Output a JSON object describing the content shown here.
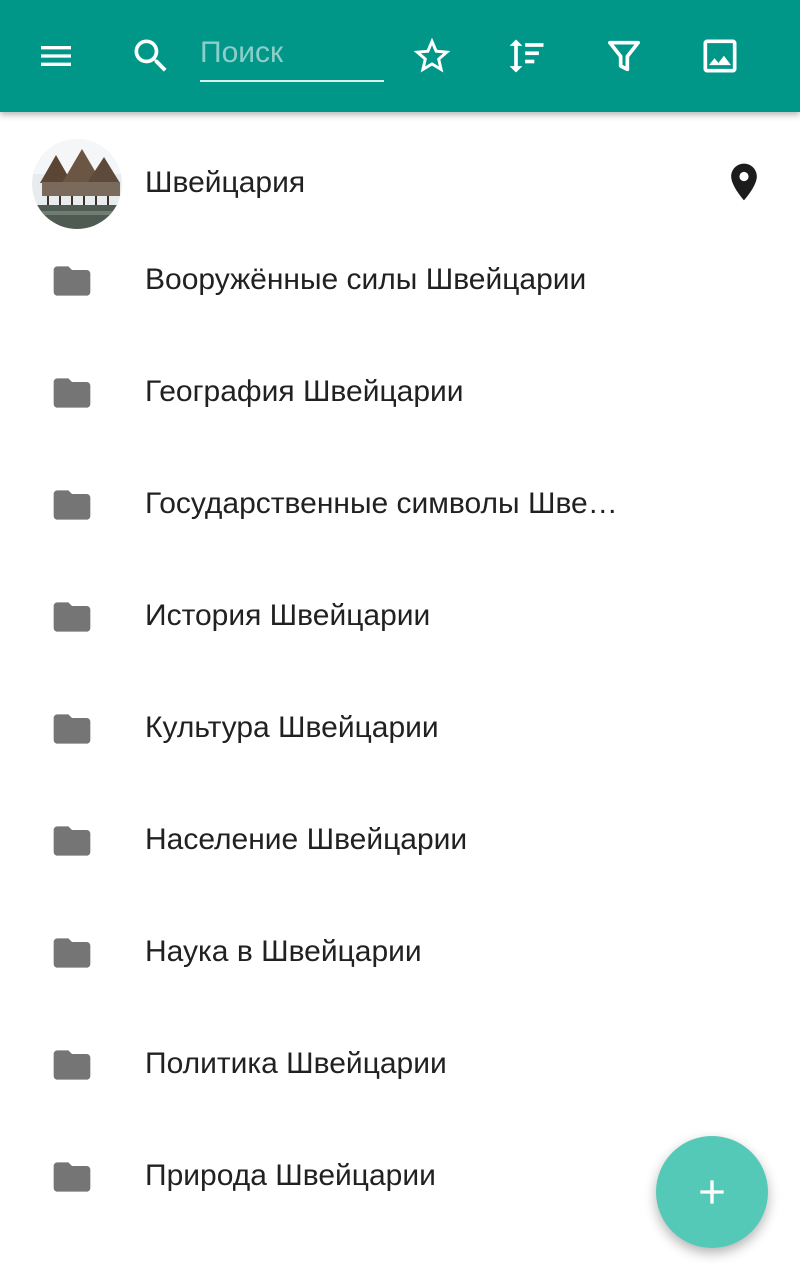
{
  "colors": {
    "toolbar": "#009688",
    "fab": "#55c9b7",
    "icon_gray": "#757575",
    "text": "#212121"
  },
  "toolbar": {
    "search_placeholder": "Поиск",
    "icons": [
      "menu-icon",
      "search-icon",
      "star-outline-icon",
      "sort-icon",
      "filter-icon",
      "image-icon"
    ]
  },
  "list": {
    "header_item": {
      "label": "Швейцария",
      "avatar": "stilt-houses-photo",
      "trailing_icon": "map-pin-icon"
    },
    "folders": [
      {
        "label": "Вооружённые силы Швейцарии",
        "icon": "folder-icon"
      },
      {
        "label": "География Швейцарии",
        "icon": "folder-icon"
      },
      {
        "label": "Государственные символы Шве…",
        "icon": "folder-icon"
      },
      {
        "label": "История Швейцарии",
        "icon": "folder-icon"
      },
      {
        "label": "Культура Швейцарии",
        "icon": "folder-icon"
      },
      {
        "label": "Население Швейцарии",
        "icon": "folder-icon"
      },
      {
        "label": "Наука в Швейцарии",
        "icon": "folder-icon"
      },
      {
        "label": "Политика Швейцарии",
        "icon": "folder-icon"
      },
      {
        "label": "Природа Швейцарии",
        "icon": "folder-icon"
      }
    ]
  },
  "fab": {
    "icon": "plus-icon"
  }
}
